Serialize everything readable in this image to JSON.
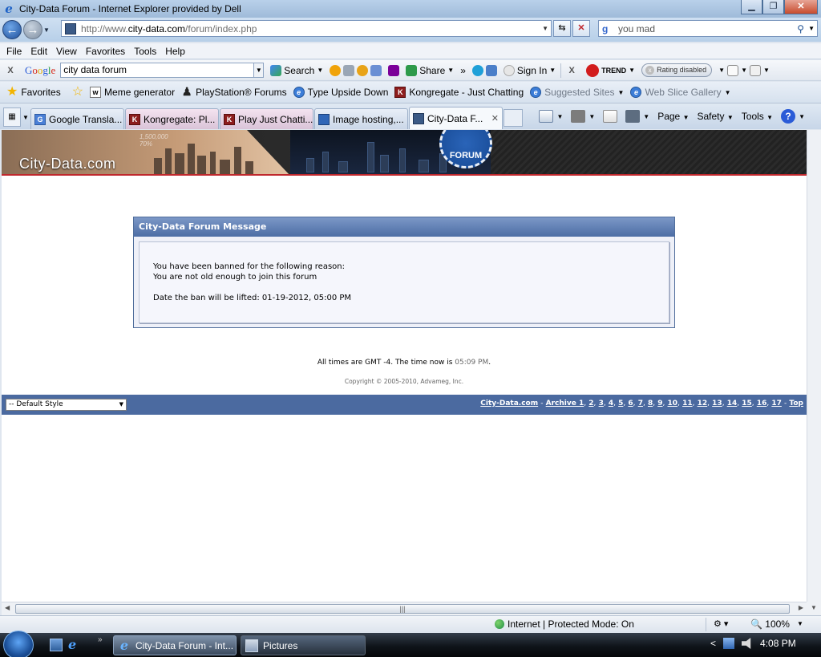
{
  "window": {
    "title": "City-Data Forum - Internet Explorer provided by Dell",
    "minimize": "▁",
    "restore": "❐",
    "close": "✕"
  },
  "address": {
    "url_prefix": "http://www.",
    "url_domain": "city-data.com",
    "url_path": "/forum/index.php"
  },
  "search": {
    "value": "you mad"
  },
  "menu": [
    "File",
    "Edit",
    "View",
    "Favorites",
    "Tools",
    "Help"
  ],
  "google_toolbar": {
    "logo": "Google",
    "query": "city data forum",
    "search_label": "Search",
    "share_label": "Share",
    "signin_label": "Sign In",
    "trend_label": "TREND",
    "rating_label": "Rating disabled"
  },
  "favorites_bar": {
    "favorites_label": "Favorites",
    "items": [
      {
        "label": "Meme generator",
        "icon": "wiki-icon"
      },
      {
        "label": "PlayStation® Forums",
        "icon": "playstation-icon"
      },
      {
        "label": "Type Upside Down",
        "icon": "ie-icon"
      },
      {
        "label": "Kongregate - Just Chatting",
        "icon": "kongregate-icon"
      },
      {
        "label": "Suggested Sites",
        "icon": "ie-icon"
      },
      {
        "label": "Web Slice Gallery",
        "icon": "ie-icon"
      }
    ]
  },
  "tabs": [
    {
      "label": "Google Transla...",
      "icon": "google-translate-icon"
    },
    {
      "label": "Kongregate: Pl...",
      "icon": "kongregate-icon"
    },
    {
      "label": "Play Just Chatti...",
      "icon": "kongregate-icon"
    },
    {
      "label": "Image hosting,...",
      "icon": "photobucket-icon"
    },
    {
      "label": "City-Data F...",
      "icon": "city-data-icon"
    }
  ],
  "command_bar": {
    "page": "Page",
    "safety": "Safety",
    "tools": "Tools",
    "help": "?"
  },
  "banner": {
    "logo_text": "City-Data.com",
    "population": "1,500,000",
    "percent": "70%",
    "seal_text": "FORUM"
  },
  "message": {
    "header": "City-Data Forum Message",
    "line1": "You have been banned for the following reason:",
    "line2": "You are not old enough to join this forum",
    "line3": "Date the ban will be lifted: 01-19-2012, 05:00 PM"
  },
  "footer": {
    "times_prefix": "All times are GMT -4. The time now is ",
    "time_now": "05:09 PM",
    "times_suffix": ".",
    "copyright": "Copyright © 2005-2010, Advameg, Inc.",
    "style_select": "-- Default Style",
    "site_link": "City-Data.com",
    "archive_label": "Archive 1",
    "archive_pages": [
      "2",
      "3",
      "4",
      "5",
      "6",
      "7",
      "8",
      "9",
      "10",
      "11",
      "12",
      "13",
      "14",
      "15",
      "16",
      "17"
    ],
    "top_link": "Top"
  },
  "status": {
    "zone": "Internet | Protected Mode: On",
    "zoom": "100%"
  },
  "taskbar": {
    "items": [
      {
        "label": "City-Data Forum - Int...",
        "icon": "ie-icon"
      },
      {
        "label": "Pictures",
        "icon": "pictures-folder-icon"
      }
    ],
    "clock": "4:08 PM"
  }
}
